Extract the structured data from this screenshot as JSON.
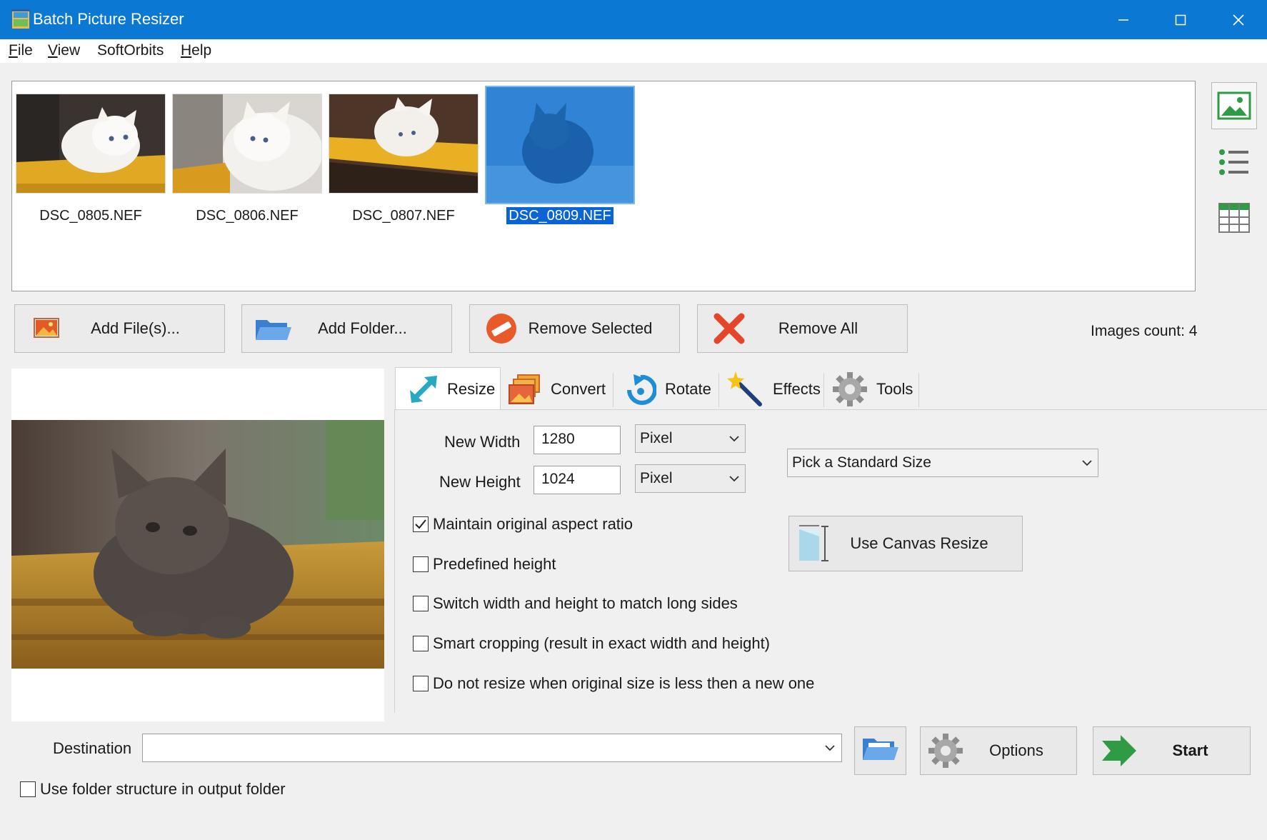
{
  "window": {
    "title": "Batch Picture Resizer",
    "accent": "#0b78d4"
  },
  "menu": [
    {
      "label": "File",
      "mnemonic": "F",
      "rest": "ile"
    },
    {
      "label": "View",
      "mnemonic": "V",
      "rest": "iew"
    },
    {
      "label": "SoftOrbits",
      "mnemonic": "",
      "rest": "SoftOrbits"
    },
    {
      "label": "Help",
      "mnemonic": "H",
      "rest": "elp"
    }
  ],
  "thumbnails": [
    {
      "name": "DSC_0805.NEF",
      "selected": false
    },
    {
      "name": "DSC_0806.NEF",
      "selected": false
    },
    {
      "name": "DSC_0807.NEF",
      "selected": false
    },
    {
      "name": "DSC_0809.NEF",
      "selected": true
    }
  ],
  "view_buttons": [
    "thumbnails-view-icon",
    "list-view-icon",
    "table-view-icon"
  ],
  "actions": {
    "add_files": "Add File(s)...",
    "add_folder": "Add Folder...",
    "remove_selected": "Remove Selected",
    "remove_all": "Remove All"
  },
  "images_count": "Images count: 4",
  "tabs": [
    "Resize",
    "Convert",
    "Rotate",
    "Effects",
    "Tools"
  ],
  "resize": {
    "new_width_label": "New Width",
    "new_width_value": "1280",
    "width_unit": "Pixel",
    "new_height_label": "New Height",
    "new_height_value": "1024",
    "height_unit": "Pixel",
    "standard_size": "Pick a Standard Size",
    "canvas_resize": "Use Canvas Resize",
    "options": [
      {
        "label": "Maintain original aspect ratio",
        "checked": true
      },
      {
        "label": "Predefined height",
        "checked": false
      },
      {
        "label": "Switch width and height to match long sides",
        "checked": false
      },
      {
        "label": "Smart cropping (result in exact width and height)",
        "checked": false
      },
      {
        "label": "Do not resize when original size is less then a new one",
        "checked": false
      }
    ]
  },
  "bottom": {
    "destination_label": "Destination",
    "destination_value": "",
    "options_label": "Options",
    "start_label": "Start",
    "use_folder_structure": "Use folder structure in output folder",
    "use_folder_structure_checked": false
  }
}
